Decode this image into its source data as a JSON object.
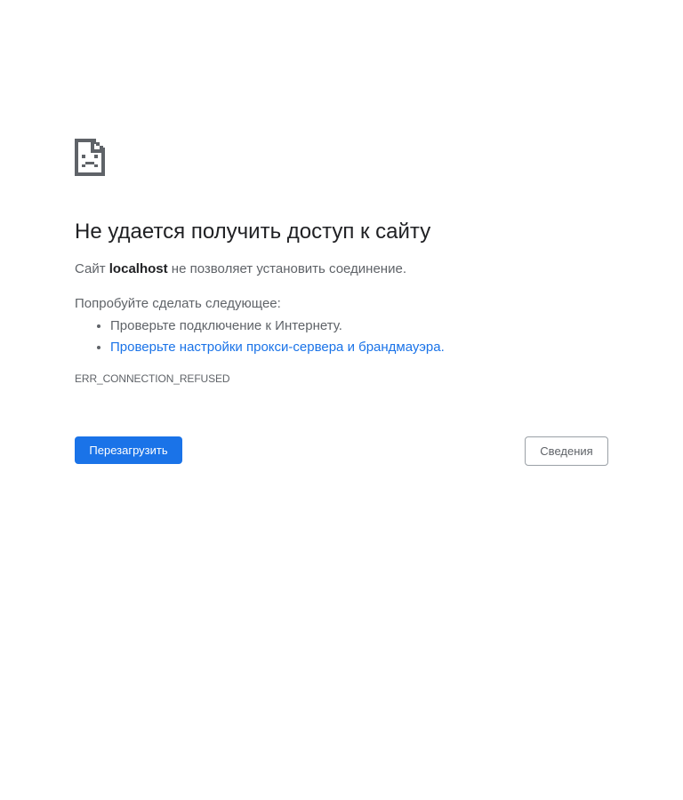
{
  "icon": "sad-page-icon",
  "heading": "Не удается получить доступ к сайту",
  "summary": {
    "prefix": "Сайт ",
    "host": "localhost",
    "suffix": " не позволяет установить соединение."
  },
  "suggestions": {
    "intro": "Попробуйте сделать следующее:",
    "items": [
      {
        "text": "Проверьте подключение к Интернету.",
        "link": false
      },
      {
        "text": "Проверьте настройки прокси-сервера и брандмауэра.",
        "link": true
      }
    ]
  },
  "error_code": "ERR_CONNECTION_REFUSED",
  "buttons": {
    "reload": "Перезагрузить",
    "details": "Сведения"
  },
  "colors": {
    "accent": "#1a73e8",
    "heading": "#202124",
    "text": "#5f6368"
  }
}
